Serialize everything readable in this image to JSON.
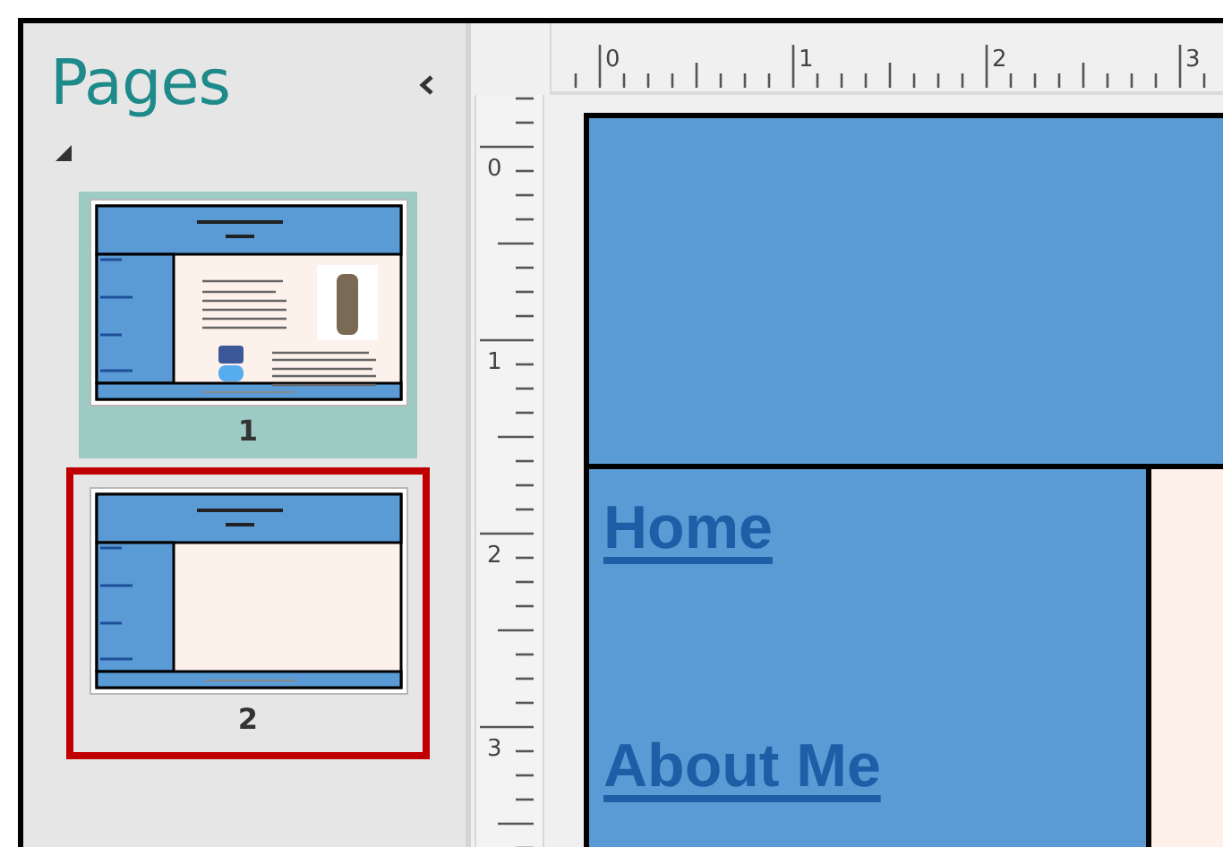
{
  "panel": {
    "title": "Pages"
  },
  "pages": [
    {
      "number": "1",
      "selected": true,
      "highlighted": false,
      "kind": "content"
    },
    {
      "number": "2",
      "selected": false,
      "highlighted": true,
      "kind": "blank"
    }
  ],
  "rulers": {
    "horizontal": [
      "0",
      "1",
      "2",
      "3"
    ],
    "vertical": [
      "0",
      "1",
      "2",
      "3"
    ]
  },
  "page": {
    "nav_links": [
      "Home",
      "About Me"
    ]
  }
}
